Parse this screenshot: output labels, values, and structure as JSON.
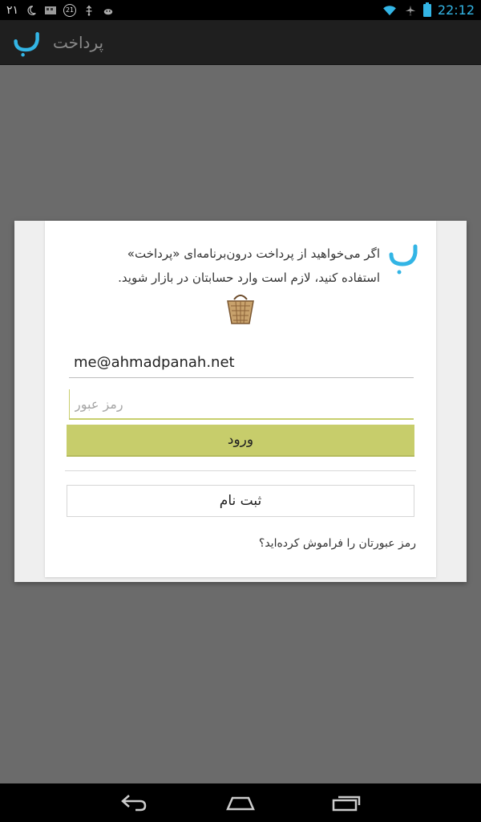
{
  "status_bar": {
    "left_number": "۲۱",
    "badge_number": "21",
    "time": "22:12"
  },
  "action_bar": {
    "title": "پرداخت",
    "logo_icon": "pardakht-logo-icon"
  },
  "dialog": {
    "intro_line1": "اگر می‌خواهید از پرداخت درون‌برنامه‌ای «پرداخت»",
    "intro_line2": "استفاده کنید، لازم است وارد حسابتان در بازار شوید.",
    "email_value": "me@ahmadpanah.net",
    "password_placeholder": "رمز عبور",
    "login_label": "ورود",
    "register_label": "ثبت نام",
    "forgot_label": "رمز عبورتان را فراموش کرده‌اید؟"
  },
  "colors": {
    "accent": "#33b5e5",
    "login_button": "#c7cd6b",
    "action_bar": "#1f1f1f",
    "backdrop": "#6b6b6b"
  }
}
